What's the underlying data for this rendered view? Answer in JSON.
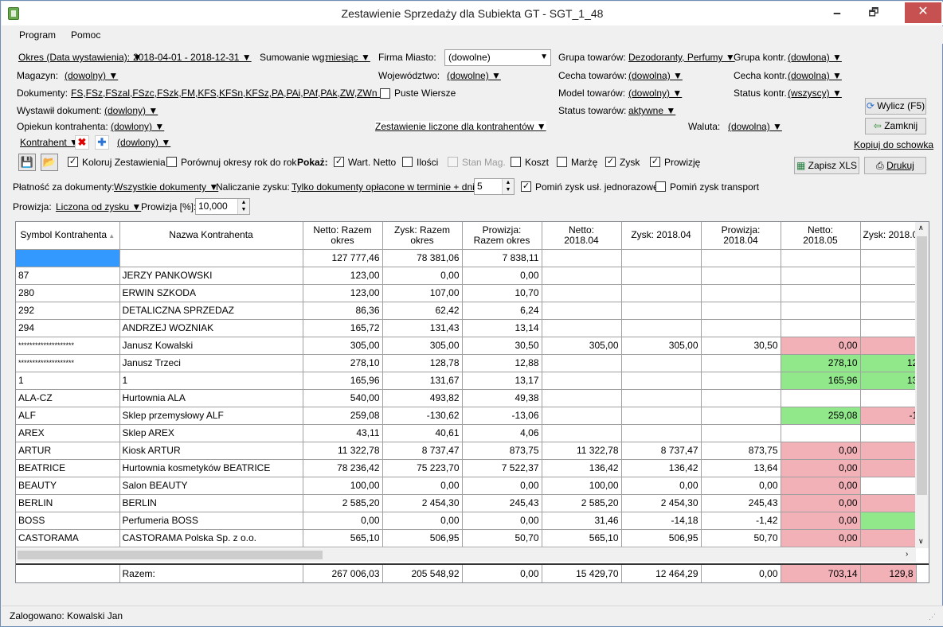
{
  "window": {
    "title": "Zestawienie Sprzedaży dla Subiekta GT - SGT_1_48",
    "minimize_glyph": "🗕",
    "restore_glyph": "🗗",
    "close_glyph": "✕"
  },
  "menu": [
    "Program",
    "Pomoc"
  ],
  "filters": {
    "okres_label": "Okres (Data wystawienia): ▼",
    "okres_value": "2018-04-01 - 2018-12-31 ▼",
    "sumowanie_label": "Sumowanie wg:",
    "sumowanie_value": "miesiąc ▼",
    "firma_label": "Firma Miasto:",
    "firma_value": "(dowolne)",
    "grupa_towarow_label": "Grupa towarów:",
    "grupa_towarow_value": "Dezodoranty, Perfumy ▼",
    "grupa_kontr_label": "Grupa kontr.",
    "grupa_kontr_value": "(dowlona) ▼",
    "magazyn_label": "Magazyn:",
    "magazyn_value": "(dowolny) ▼",
    "wojewodztwo_label": "Województwo:",
    "wojewodztwo_value": "(dowolne) ▼",
    "cecha_towarow_label": "Cecha towarów:",
    "cecha_towarow_value": "(dowolna) ▼",
    "cecha_kontr_label": "Cecha kontr.",
    "cecha_kontr_value": "(dowolna) ▼",
    "dokumenty_label": "Dokumenty:",
    "dokumenty_value": "FS,FSz,FSzal,FSzc,FSzk,FM,KFS,KFSn,KFSz,PA,PAi,PAf,PAk,ZW,ZWn ▼",
    "puste_wiersze": "Puste Wiersze",
    "model_towarow_label": "Model towarów:",
    "model_towarow_value": "(dowolny) ▼",
    "status_kontr_label": "Status kontr.",
    "status_kontr_value": "(wszyscy) ▼",
    "wystawil_label": "Wystawił dokument:",
    "wystawil_value": "(dowlony) ▼",
    "status_towarow_label": "Status towarów:",
    "status_towarow_value": "aktywne ▼",
    "opiekun_label": "Opiekun kontrahenta:",
    "opiekun_value": "(dowlony) ▼",
    "zestawienie_value": "Zestawienie liczone dla kontrahentów ▼",
    "waluta_label": "Waluta:",
    "waluta_value": "(dowolna) ▼",
    "kontrahent_label": "Kontrahent ▼",
    "kontrahent_value": "(dowlony) ▼"
  },
  "buttons": {
    "wylicz": "Wylicz (F5)",
    "zamknij": "Zamknij",
    "kopiuj": "Kopiuj do schowka",
    "zapisz_xls": "Zapisz XLS",
    "drukuj": "Drukuj"
  },
  "options": {
    "koloruj": "Koloruj Zestawienia",
    "porownaj": "Porównuj okresy rok do rok",
    "pokaz": "Pokaż:",
    "wart_netto": "Wart. Netto",
    "ilosci": "Ilości",
    "stan_mag": "Stan Mag.",
    "koszt": "Koszt",
    "marze": "Marżę",
    "zysk": "Zysk",
    "prowizje": "Prowizję"
  },
  "payment": {
    "platnosc_label": "Płatność za dokumenty:",
    "platnosc_value": "Wszystkie dokumenty ▼",
    "naliczanie_label": "Naliczanie zysku:",
    "naliczanie_value": "Tylko dokumenty opłacone w terminie + dni: ▼",
    "dni_value": "5",
    "pomin_uslugi": "Pomiń zysk usł. jednorazowe",
    "pomin_transport": "Pomiń zysk transport"
  },
  "prowizja": {
    "label": "Prowizja:",
    "value": "Liczona od zysku ▼",
    "pct_label": "Prowizja [%]:",
    "pct_value": "10,000"
  },
  "table": {
    "headers": [
      "Symbol Kontrahenta",
      "Nazwa Kontrahenta",
      "Netto: Razem\nokres",
      "Zysk: Razem\nokres",
      "Prowizja:\nRazem okres",
      "Netto:\n2018.04",
      "Zysk: 2018.04",
      "Prowizja:\n2018.04",
      "Netto:\n2018.05",
      "Zysk: 2018.0"
    ],
    "sort_glyph": "▲",
    "rows": [
      {
        "c": [
          "",
          "",
          "127 777,46",
          "78 381,06",
          "7 838,11",
          "",
          "",
          "",
          "",
          ""
        ],
        "s": [
          "sel",
          "",
          "",
          "",
          "",
          "",
          "",
          "",
          "",
          ""
        ]
      },
      {
        "c": [
          "87",
          "JERZY PANKOWSKI",
          "123,00",
          "0,00",
          "0,00",
          "",
          "",
          "",
          "",
          ""
        ]
      },
      {
        "c": [
          "280",
          "ERWIN SZKODA",
          "123,00",
          "107,00",
          "10,70",
          "",
          "",
          "",
          "",
          ""
        ]
      },
      {
        "c": [
          "292",
          "DETALICZNA SPRZEDAZ",
          "86,36",
          "62,42",
          "6,24",
          "",
          "",
          "",
          "",
          ""
        ]
      },
      {
        "c": [
          "294",
          "ANDRZEJ WOZNIAK",
          "165,72",
          "131,43",
          "13,14",
          "",
          "",
          "",
          "",
          ""
        ]
      },
      {
        "c": [
          "********************",
          "Janusz Kowalski",
          "305,00",
          "305,00",
          "30,50",
          "305,00",
          "305,00",
          "30,50",
          "0,00",
          ""
        ],
        "s": [
          "",
          "",
          "",
          "",
          "",
          "",
          "",
          "",
          "red",
          "red"
        ]
      },
      {
        "c": [
          "********************",
          "Janusz Trzeci",
          "278,10",
          "128,78",
          "12,88",
          "",
          "",
          "",
          "278,10",
          "12"
        ],
        "s": [
          "",
          "",
          "",
          "",
          "",
          "",
          "",
          "",
          "green",
          "green"
        ]
      },
      {
        "c": [
          "1",
          "1",
          "165,96",
          "131,67",
          "13,17",
          "",
          "",
          "",
          "165,96",
          "13"
        ],
        "s": [
          "",
          "",
          "",
          "",
          "",
          "",
          "",
          "",
          "green",
          "green"
        ]
      },
      {
        "c": [
          "ALA-CZ",
          "Hurtownia ALA",
          "540,00",
          "493,82",
          "49,38",
          "",
          "",
          "",
          "",
          ""
        ]
      },
      {
        "c": [
          "ALF",
          "Sklep przemysłowy ALF",
          "259,08",
          "-130,62",
          "-13,06",
          "",
          "",
          "",
          "259,08",
          "-1"
        ],
        "s": [
          "",
          "",
          "",
          "",
          "",
          "",
          "",
          "",
          "green",
          "red"
        ]
      },
      {
        "c": [
          "AREX",
          "Sklep AREX",
          "43,11",
          "40,61",
          "4,06",
          "",
          "",
          "",
          "",
          ""
        ]
      },
      {
        "c": [
          "ARTUR",
          "Kiosk ARTUR",
          "11 322,78",
          "8 737,47",
          "873,75",
          "11 322,78",
          "8 737,47",
          "873,75",
          "0,00",
          ""
        ],
        "s": [
          "",
          "",
          "",
          "",
          "",
          "",
          "",
          "",
          "red",
          "red"
        ]
      },
      {
        "c": [
          "BEATRICE",
          "Hurtownia kosmetyków BEATRICE",
          "78 236,42",
          "75 223,70",
          "7 522,37",
          "136,42",
          "136,42",
          "13,64",
          "0,00",
          ""
        ],
        "s": [
          "",
          "",
          "",
          "",
          "",
          "",
          "",
          "",
          "red",
          "red"
        ]
      },
      {
        "c": [
          "BEAUTY",
          "Salon BEAUTY",
          "100,00",
          "0,00",
          "0,00",
          "100,00",
          "0,00",
          "0,00",
          "0,00",
          ""
        ],
        "s": [
          "",
          "",
          "",
          "",
          "",
          "",
          "",
          "",
          "red",
          ""
        ]
      },
      {
        "c": [
          "BERLIN",
          "BERLIN",
          "2 585,20",
          "2 454,30",
          "245,43",
          "2 585,20",
          "2 454,30",
          "245,43",
          "0,00",
          ""
        ],
        "s": [
          "",
          "",
          "",
          "",
          "",
          "",
          "",
          "",
          "red",
          "red"
        ]
      },
      {
        "c": [
          "BOSS",
          "Perfumeria BOSS",
          "0,00",
          "0,00",
          "0,00",
          "31,46",
          "-14,18",
          "-1,42",
          "0,00",
          ""
        ],
        "s": [
          "",
          "",
          "",
          "",
          "",
          "",
          "",
          "",
          "red",
          "green"
        ]
      },
      {
        "c": [
          "CASTORAMA",
          "CASTORAMA Polska Sp. z o.o.",
          "565,10",
          "506,95",
          "50,70",
          "565,10",
          "506,95",
          "50,70",
          "0,00",
          ""
        ],
        "s": [
          "",
          "",
          "",
          "",
          "",
          "",
          "",
          "",
          "red",
          "red"
        ]
      }
    ],
    "totals": {
      "c": [
        "",
        "Razem:",
        "267 006,03",
        "205 548,92",
        "0,00",
        "15 429,70",
        "12 464,29",
        "0,00",
        "703,14",
        "129,8"
      ],
      "s": [
        "",
        "",
        "",
        "",
        "",
        "",
        "",
        "",
        "red",
        "red"
      ]
    }
  },
  "status": {
    "logged": "Zalogowano: Kowalski Jan"
  }
}
